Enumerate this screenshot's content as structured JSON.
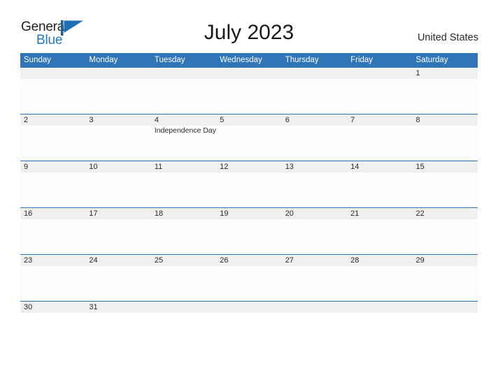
{
  "brand": {
    "word_one": "General",
    "word_two": "Blue",
    "flag_icon": "blue-triangle-flag-icon",
    "color_dark": "#231f20",
    "color_blue": "#1f7ac4",
    "flag_color": "#1f6fb5"
  },
  "header": {
    "title": "July 2023",
    "region": "United States"
  },
  "colors": {
    "header_blue": "#3075b8",
    "divider_blue": "#2e75b6",
    "daynum_band_gray": "#f0f0f0",
    "page_background": "#ffffff"
  },
  "weekdays": [
    "Sunday",
    "Monday",
    "Tuesday",
    "Wednesday",
    "Thursday",
    "Friday",
    "Saturday"
  ],
  "weeks": [
    {
      "days": [
        {
          "num": "",
          "event": ""
        },
        {
          "num": "",
          "event": ""
        },
        {
          "num": "",
          "event": ""
        },
        {
          "num": "",
          "event": ""
        },
        {
          "num": "",
          "event": ""
        },
        {
          "num": "",
          "event": ""
        },
        {
          "num": "1",
          "event": ""
        }
      ]
    },
    {
      "days": [
        {
          "num": "2",
          "event": ""
        },
        {
          "num": "3",
          "event": ""
        },
        {
          "num": "4",
          "event": "Independence Day"
        },
        {
          "num": "5",
          "event": ""
        },
        {
          "num": "6",
          "event": ""
        },
        {
          "num": "7",
          "event": ""
        },
        {
          "num": "8",
          "event": ""
        }
      ]
    },
    {
      "days": [
        {
          "num": "9",
          "event": ""
        },
        {
          "num": "10",
          "event": ""
        },
        {
          "num": "11",
          "event": ""
        },
        {
          "num": "12",
          "event": ""
        },
        {
          "num": "13",
          "event": ""
        },
        {
          "num": "14",
          "event": ""
        },
        {
          "num": "15",
          "event": ""
        }
      ]
    },
    {
      "days": [
        {
          "num": "16",
          "event": ""
        },
        {
          "num": "17",
          "event": ""
        },
        {
          "num": "18",
          "event": ""
        },
        {
          "num": "19",
          "event": ""
        },
        {
          "num": "20",
          "event": ""
        },
        {
          "num": "21",
          "event": ""
        },
        {
          "num": "22",
          "event": ""
        }
      ]
    },
    {
      "days": [
        {
          "num": "23",
          "event": ""
        },
        {
          "num": "24",
          "event": ""
        },
        {
          "num": "25",
          "event": ""
        },
        {
          "num": "26",
          "event": ""
        },
        {
          "num": "27",
          "event": ""
        },
        {
          "num": "28",
          "event": ""
        },
        {
          "num": "29",
          "event": ""
        }
      ]
    },
    {
      "days": [
        {
          "num": "30",
          "event": ""
        },
        {
          "num": "31",
          "event": ""
        },
        {
          "num": "",
          "event": ""
        },
        {
          "num": "",
          "event": ""
        },
        {
          "num": "",
          "event": ""
        },
        {
          "num": "",
          "event": ""
        },
        {
          "num": "",
          "event": ""
        }
      ]
    }
  ]
}
